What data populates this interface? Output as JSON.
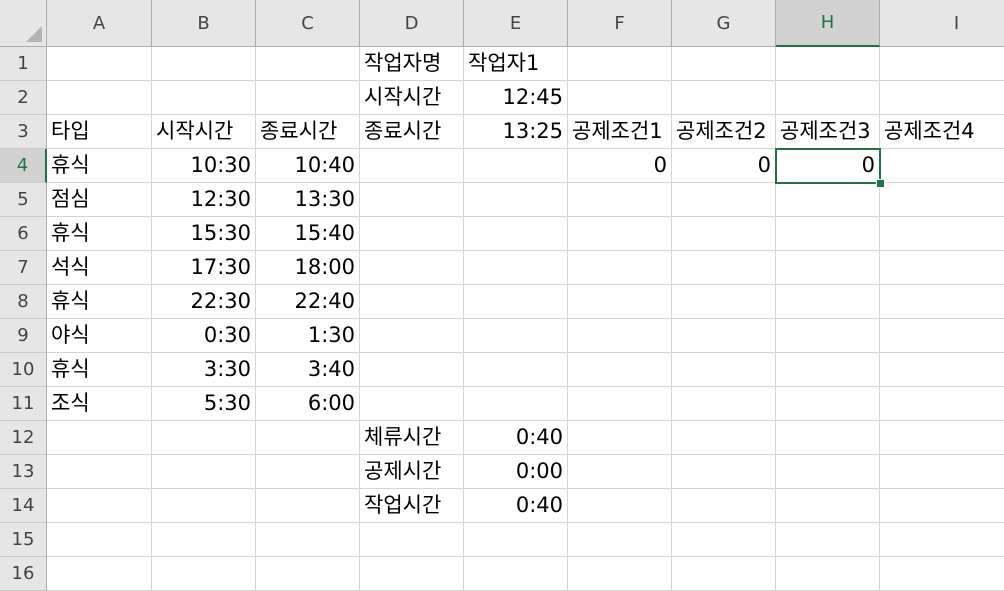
{
  "columns": [
    "A",
    "B",
    "C",
    "D",
    "E",
    "F",
    "G",
    "H",
    "I"
  ],
  "rows": [
    "1",
    "2",
    "3",
    "4",
    "5",
    "6",
    "7",
    "8",
    "9",
    "10",
    "11",
    "12",
    "13",
    "14",
    "15",
    "16"
  ],
  "selected": {
    "col": "H",
    "row": "4"
  },
  "cells": {
    "D1": "작업자명",
    "E1": "작업자1",
    "D2": "시작시간",
    "E2": "12:45",
    "A3": "타입",
    "B3": "시작시간",
    "C3": "종료시간",
    "D3": "종료시간",
    "E3": "13:25",
    "F3": "공제조건1",
    "G3": "공제조건2",
    "H3": "공제조건3",
    "I3": "공제조건4",
    "A4": "휴식",
    "B4": "10:30",
    "C4": "10:40",
    "F4": "0",
    "G4": "0",
    "H4": "0",
    "A5": "점심",
    "B5": "12:30",
    "C5": "13:30",
    "A6": "휴식",
    "B6": "15:30",
    "C6": "15:40",
    "A7": "석식",
    "B7": "17:30",
    "C7": "18:00",
    "A8": "휴식",
    "B8": "22:30",
    "C8": "22:40",
    "A9": "야식",
    "B9": "0:30",
    "C9": "1:30",
    "A10": "휴식",
    "B10": "3:30",
    "C10": "3:40",
    "A11": "조식",
    "B11": "5:30",
    "C11": "6:00",
    "D12": "체류시간",
    "E12": "0:40",
    "D13": "공제시간",
    "E13": "0:00",
    "D14": "작업시간",
    "E14": "0:40"
  },
  "colors": {
    "accent": "#217346",
    "header_bg": "#e6e6e6",
    "gridline": "#d4d4d4"
  }
}
